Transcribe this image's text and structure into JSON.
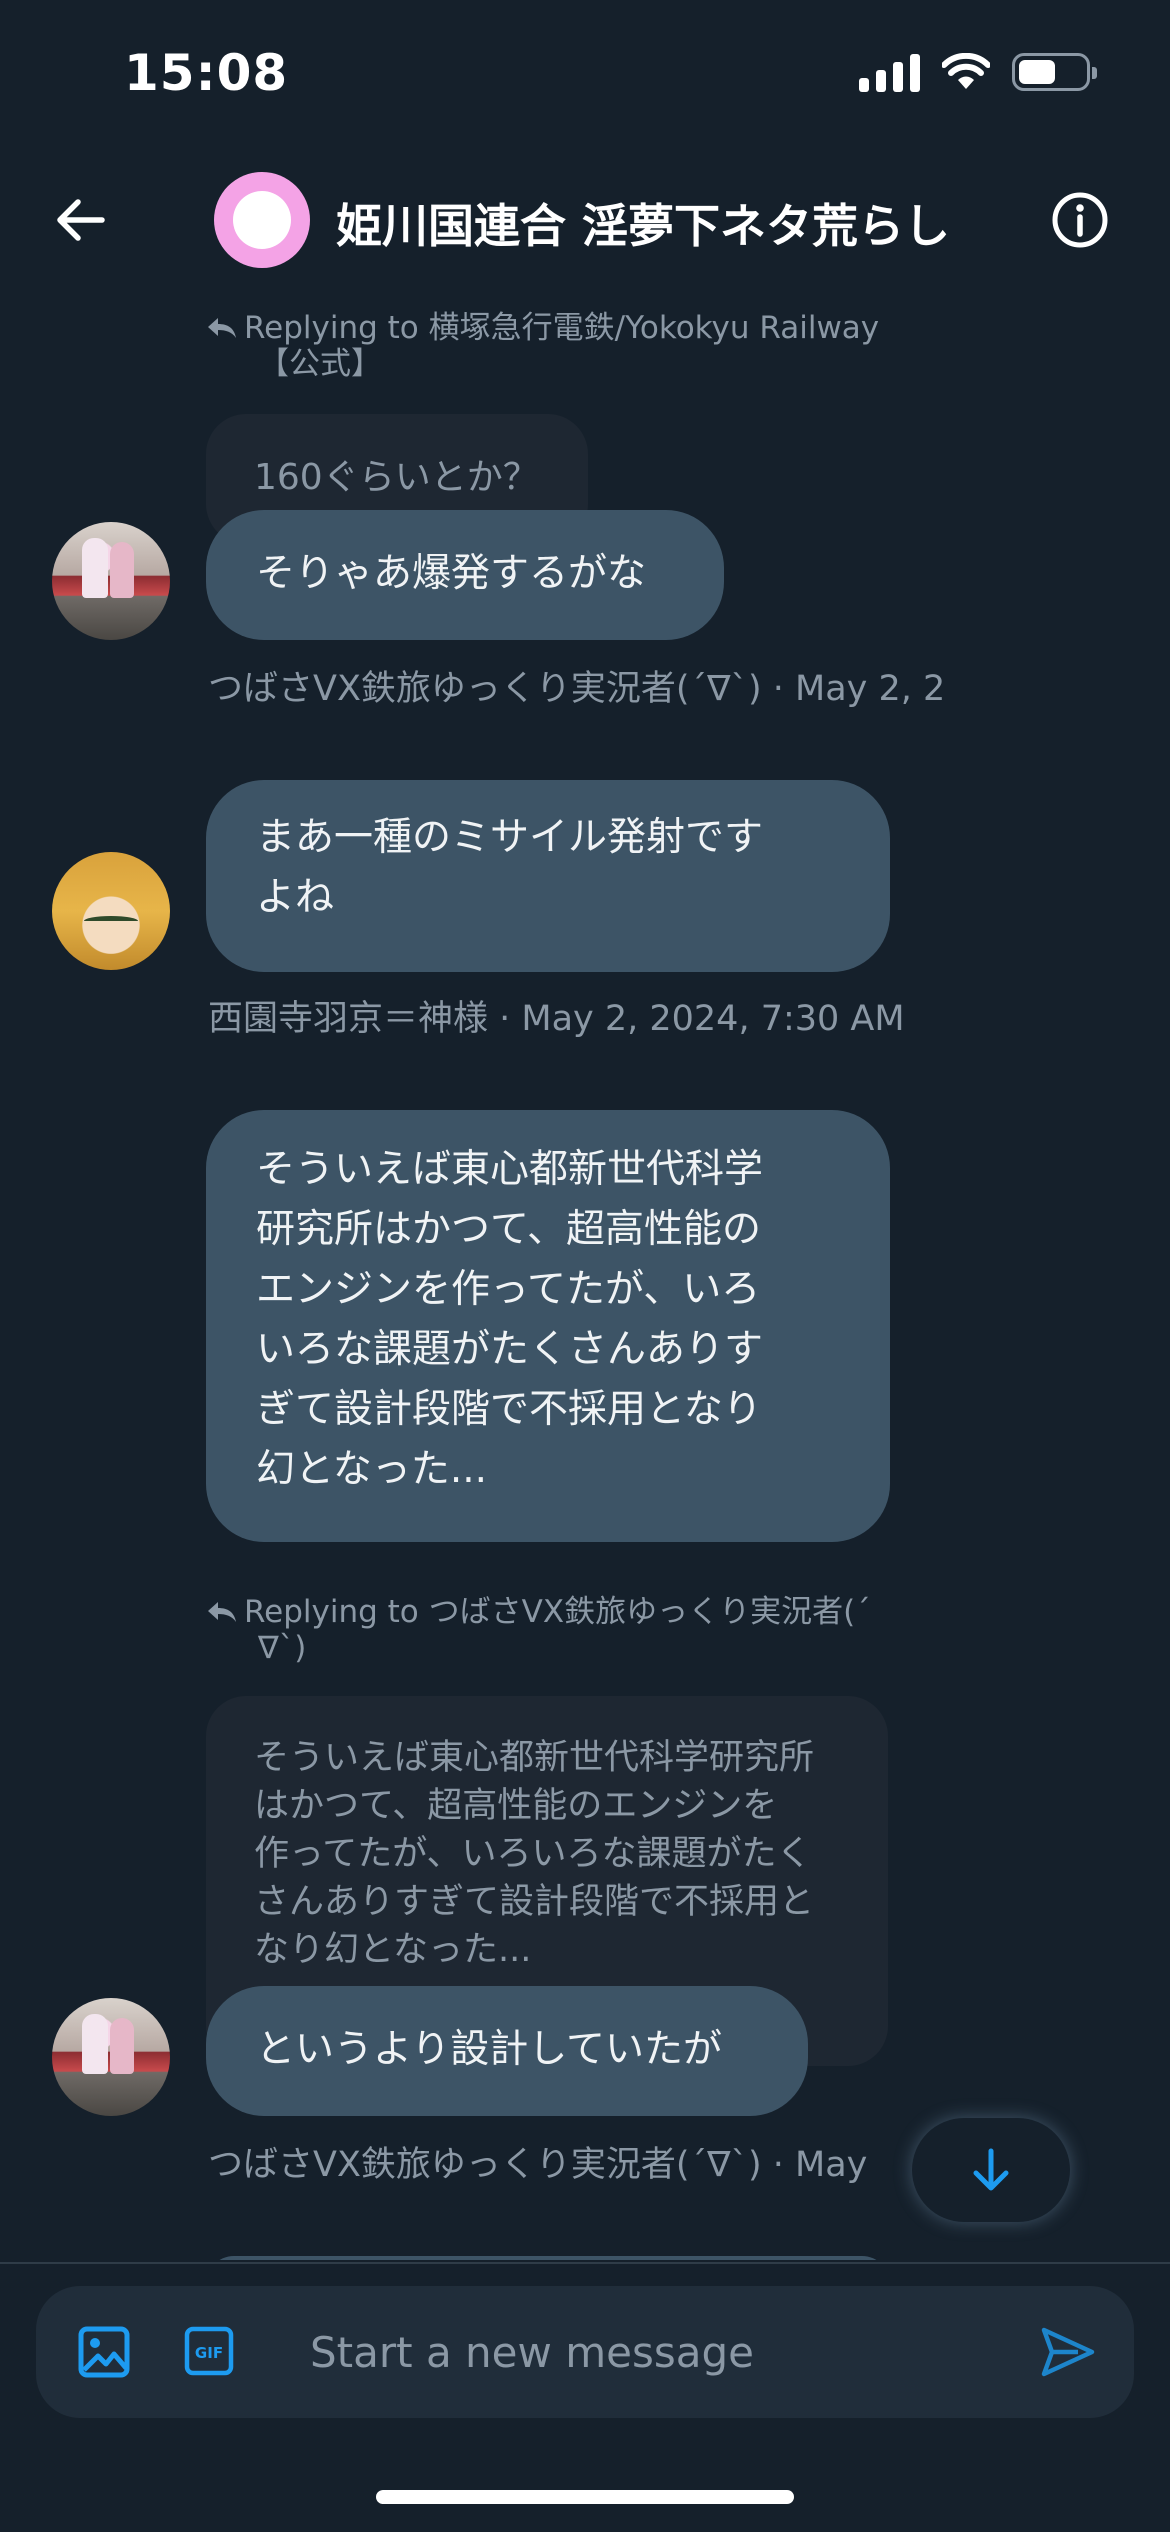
{
  "status_bar": {
    "time": "15:08"
  },
  "header": {
    "title": "姫川国連合 淫夢下ネタ荒らし",
    "avatar_color": "#f4a3e6"
  },
  "messages": [
    {
      "reply_to": "Replying to 横塚急行電鉄/Yokokyu Railway",
      "reply_to_cont": "【公式】",
      "quoted": "160ぐらいとか？",
      "text": "そりゃあ爆発するがな",
      "meta": "つばさVX鉄旅ゆっくり実況者(´∇`) · May 2, 2"
    },
    {
      "text_lines": [
        "まあ一種のミサイル発射です",
        "よね"
      ],
      "meta": "西園寺羽京＝神様 · May 2, 2024, 7:30 AM"
    },
    {
      "text_lines": [
        "そういえば東心都新世代科学",
        "研究所はかつて、超高性能の",
        "エンジンを作ってたが、いろ",
        "いろな課題がたくさんありす",
        "ぎて設計段階で不採用となり",
        "幻となった..."
      ]
    },
    {
      "reply_to": "Replying to つばさVX鉄旅ゆっくり実況者(´",
      "reply_to_cont": "∇`)",
      "quoted_lines": [
        "そういえば東心都新世代科学研究所",
        "はかつて、超高性能のエンジンを",
        "作ってたが、いろいろな課題がたく",
        "さんありすぎて設計段階で不採用と",
        "なり幻となった..."
      ],
      "text": "というより設計していたが",
      "meta": "つばさVX鉄旅ゆっくり実況者(´∇`) · May"
    }
  ],
  "composer": {
    "placeholder": "Start a new message"
  },
  "colors": {
    "background": "#15202b",
    "bubble": "#3d5466",
    "quoted_bubble": "#1e2732",
    "accent": "#1d9bf0",
    "muted_text": "#8b98a5"
  },
  "icons": {
    "back": "arrow-left-icon",
    "info": "info-icon",
    "reply": "reply-arrow-icon",
    "scroll": "arrow-down-icon",
    "media": "image-icon",
    "gif": "gif-icon",
    "send": "send-icon"
  }
}
